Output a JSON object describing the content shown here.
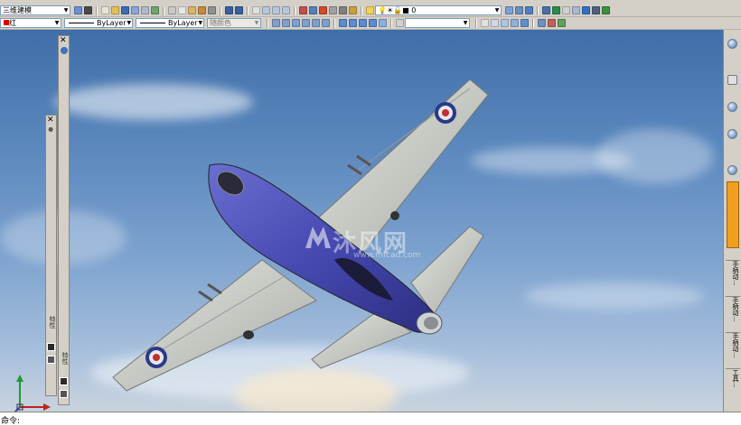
{
  "toolbar": {
    "workspace": "三维建模",
    "layer": "红",
    "linetype": "ByLayer",
    "lineweight": "ByLayer",
    "plotstyle": "随颜色",
    "layer_state": "0"
  },
  "palettes": {
    "left_tab_1": "特性",
    "left_tab_2": "特性"
  },
  "side_tabs": [
    "手柄动...",
    "手柄动...",
    "手柄动...",
    "工具..."
  ],
  "command": {
    "prompt": "命令:"
  },
  "watermark": {
    "brand": "沐风网",
    "url": "www.mfcad.com"
  },
  "colors": {
    "sky_top": "#3f6ea8",
    "fuselage": "#4a4db5",
    "wing": "#cfd2cb",
    "roundel_outer": "#2a3a8a",
    "roundel_inner": "#c03030"
  }
}
